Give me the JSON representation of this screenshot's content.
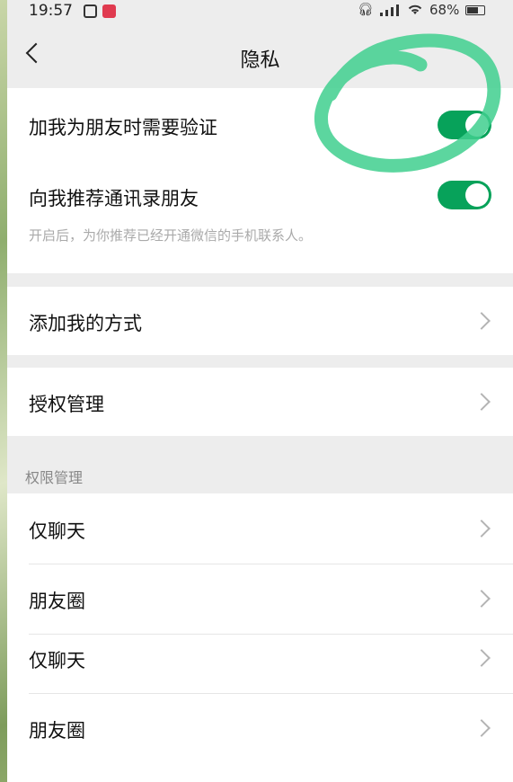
{
  "status_bar": {
    "time": "19:57",
    "battery": "68%"
  },
  "nav": {
    "title": "隐私"
  },
  "section1": {
    "verify_label": "加我为朋友时需要验证",
    "verify_on": true,
    "recommend_label": "向我推荐通讯录朋友",
    "recommend_on": true,
    "recommend_hint": "开启后，为你推荐已经开通微信的手机联系人。"
  },
  "add_me_label": "添加我的方式",
  "auth_label": "授权管理",
  "permission": {
    "header": "权限管理",
    "items": [
      {
        "label": "仅聊天"
      },
      {
        "label": "朋友圈"
      },
      {
        "label": "仅聊天"
      },
      {
        "label": "朋友圈"
      }
    ]
  },
  "colors": {
    "toggle_on": "#07a25a",
    "highlight": "#3fcf8e"
  }
}
